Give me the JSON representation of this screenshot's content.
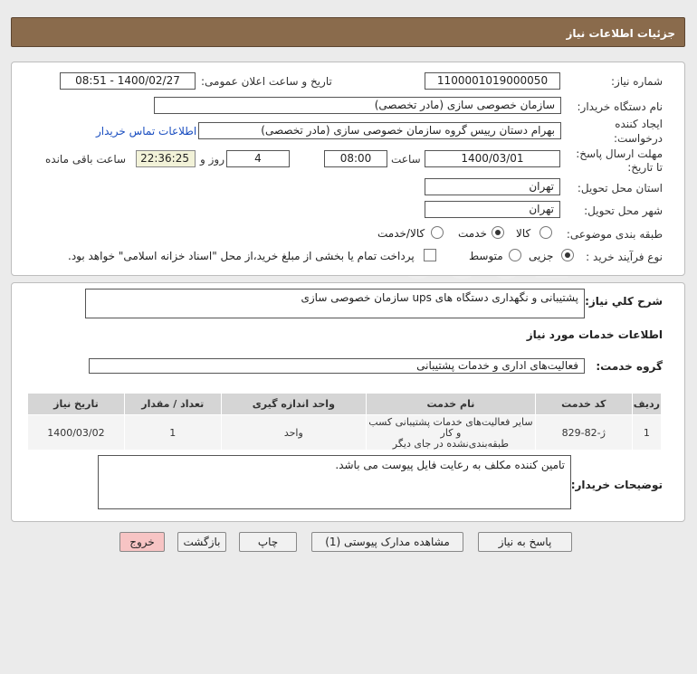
{
  "header": {
    "title": "جزئیات اطلاعات نیاز"
  },
  "info": {
    "need_number_label": "شماره نیاز:",
    "need_number": "1100001019000050",
    "announce_label": "تاریخ و ساعت اعلان عمومی:",
    "announce_value": "1400/02/27 - 08:51",
    "buyer_label": "نام دستگاه خریدار:",
    "buyer_value": "سازمان خصوصی سازی (مادر تخصصی)",
    "creator_label_1": "ایجاد کننده",
    "creator_label_2": "درخواست:",
    "creator_value": "بهرام دستان رییس گروه سازمان خصوصی سازی (مادر تخصصی)",
    "contact_link": "اطلاعات تماس خریدار",
    "deadline_label_1": "مهلت ارسال پاسخ:",
    "deadline_label_2": "تا تاریخ:",
    "deadline_date": "1400/03/01",
    "time_label": "ساعت",
    "deadline_time": "08:00",
    "days_value": "4",
    "days_label": "روز و",
    "remaining_time": "22:36:25",
    "remaining_label": "ساعت باقی مانده",
    "province_label": "استان محل تحویل:",
    "province_value": "تهران",
    "city_label": "شهر محل تحویل:",
    "city_value": "تهران",
    "category_label": "طبقه بندی موضوعی:",
    "category_options": [
      "کالا",
      "خدمت",
      "کالا/خدمت"
    ],
    "category_selected": "خدمت",
    "process_label": "نوع فرآیند خرید :",
    "process_options": [
      "جزیی",
      "متوسط"
    ],
    "process_selected": "جزیی",
    "payment_note": "پرداخت تمام یا بخشی از مبلغ خرید،از محل \"اسناد خزانه اسلامی\" خواهد بود."
  },
  "desc": {
    "label": "شرح کلي نياز:",
    "value": "پشتیبانی و نگهداری دستگاه های ups سازمان خصوصی سازی"
  },
  "services": {
    "section_title": "اطلاعات خدمات مورد نیاز",
    "group_label": "گروه خدمت:",
    "group_value": "فعالیت‌های اداری و خدمات پشتیبانی",
    "columns": [
      "ردیف",
      "کد خدمت",
      "نام خدمت",
      "واحد اندازه گیری",
      "تعداد / مقدار",
      "تاریخ نیاز"
    ],
    "rows": [
      {
        "row": "1",
        "code": "ژ-82-829",
        "name_1": "سایر فعالیت‌های خدمات پشتیبانی کسب و کار",
        "name_2": "طبقه‌بندی‌نشده در جای دیگر",
        "unit": "واحد",
        "qty": "1",
        "date": "1400/03/02"
      }
    ]
  },
  "buyer_notes": {
    "label": "توضیحات خریدار:",
    "value": "تامین کننده مکلف به رعایت فایل پیوست می باشد."
  },
  "buttons": {
    "reply": "پاسخ به نیاز",
    "attachments": "مشاهده مدارک پیوستی (1)",
    "print": "چاپ",
    "back": "بازگشت",
    "exit": "خروج"
  }
}
